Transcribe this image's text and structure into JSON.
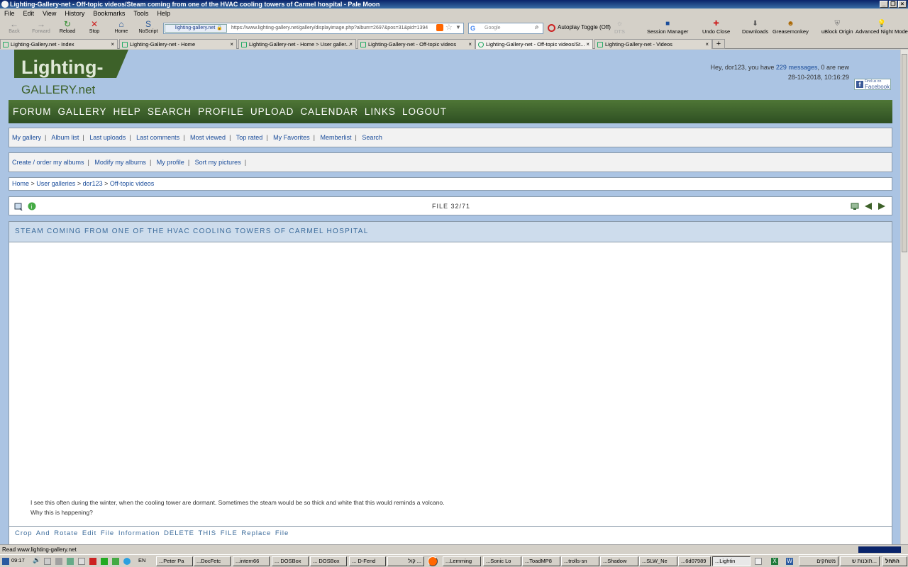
{
  "window": {
    "title": "Lighting-Gallery-net - Off-topic videos/Steam coming from one of the HVAC cooling towers of Carmel hospital - Pale Moon"
  },
  "menu": [
    "File",
    "Edit",
    "View",
    "History",
    "Bookmarks",
    "Tools",
    "Help"
  ],
  "nav": {
    "back": "Back",
    "forward": "Forward",
    "reload": "Reload",
    "stop": "Stop",
    "home": "Home",
    "noscript": "NoScript"
  },
  "url": {
    "identity": "lighting-gallery.net",
    "address": "https://www.lighting-gallery.net/gallery/displayimage.php?album=2697&pos=31&pid=1394"
  },
  "search": {
    "placeholder": "Google"
  },
  "toolbar": {
    "autoplay": "Autoplay Toggle (Off)",
    "dts": "DTS",
    "session": "Session Manager",
    "undo": "Undo Close",
    "downloads": "Downloads",
    "greasemonkey": "Greasemonkey",
    "ublock": "uBlock Origin",
    "nightmode": "Advanced Night Mode"
  },
  "tabs": [
    {
      "label": "Lighting-Gallery.net - Index"
    },
    {
      "label": "Lighting-Gallery-net - Home"
    },
    {
      "label": "Lighting-Gallery-net - Home > User galler..."
    },
    {
      "label": "Lighting-Gallery-net - Off-topic videos"
    },
    {
      "label": "Lighting-Gallery-net - Off-topic videos/St..."
    },
    {
      "label": "Lighting-Gallery-net - Videos"
    }
  ],
  "header": {
    "logo_top": "Lighting-",
    "logo_bottom": "GALLERY.net",
    "greeting_pre": "Hey, dor123, you have ",
    "messages": "229 messages",
    "greeting_post": ", 0 are new",
    "datetime": "28-10-2018, 10:16:29",
    "fb_line1": "Find us on",
    "fb_line2": "Facebook"
  },
  "mainnav": [
    "FORUM",
    "GALLERY",
    "HELP",
    "SEARCH",
    "PROFILE",
    "UPLOAD",
    "CALENDAR",
    "LINKS",
    "LOGOUT"
  ],
  "subnav1": [
    "My gallery",
    "Album list",
    "Last uploads",
    "Last comments",
    "Most viewed",
    "Top rated",
    "My Favorites",
    "Memberlist",
    "Search"
  ],
  "subnav2": [
    "Create / order my albums",
    "Modify my albums",
    "My profile",
    "Sort my pictures"
  ],
  "breadcrumb": [
    "Home",
    "User galleries",
    "dor123",
    "Off-topic videos"
  ],
  "file": {
    "counter": "FILE 32/71"
  },
  "item": {
    "title": "STEAM COMING FROM ONE OF THE HVAC COOLING TOWERS OF CARMEL HOSPITAL",
    "desc1": "I see this often during the winter, when the cooling tower are dormant. Sometimes the steam would be so thick and white that this would reminds a volcano.",
    "desc2": "Why this is happening?"
  },
  "actions": [
    "Crop And Rotate",
    "Edit File Information",
    "DELETE THIS FILE",
    "Replace File"
  ],
  "status": {
    "text": "Read www.lighting-gallery.net"
  },
  "taskbar": {
    "time": "09:17",
    "lang": "EN",
    "items": [
      "...Peter Pa",
      "...DocFetc",
      "...intern66",
      "... DOSBox",
      "... DOSBox",
      "... D-Fend",
      "קול ...",
      "...Lemming",
      "...Sonic Lo",
      "...ToadMP8",
      "...trolls-sn",
      "...Shadow",
      "...SLW_Ne",
      "...6d07989",
      "...Lightin",
      "משחקים",
      "תוכנות ש...",
      "התחל"
    ]
  },
  "colors": {
    "nav_green": "#3d6129",
    "page_bg": "#abc4e3",
    "link": "#1a4c9a",
    "title_blue": "#3a6a9a"
  }
}
